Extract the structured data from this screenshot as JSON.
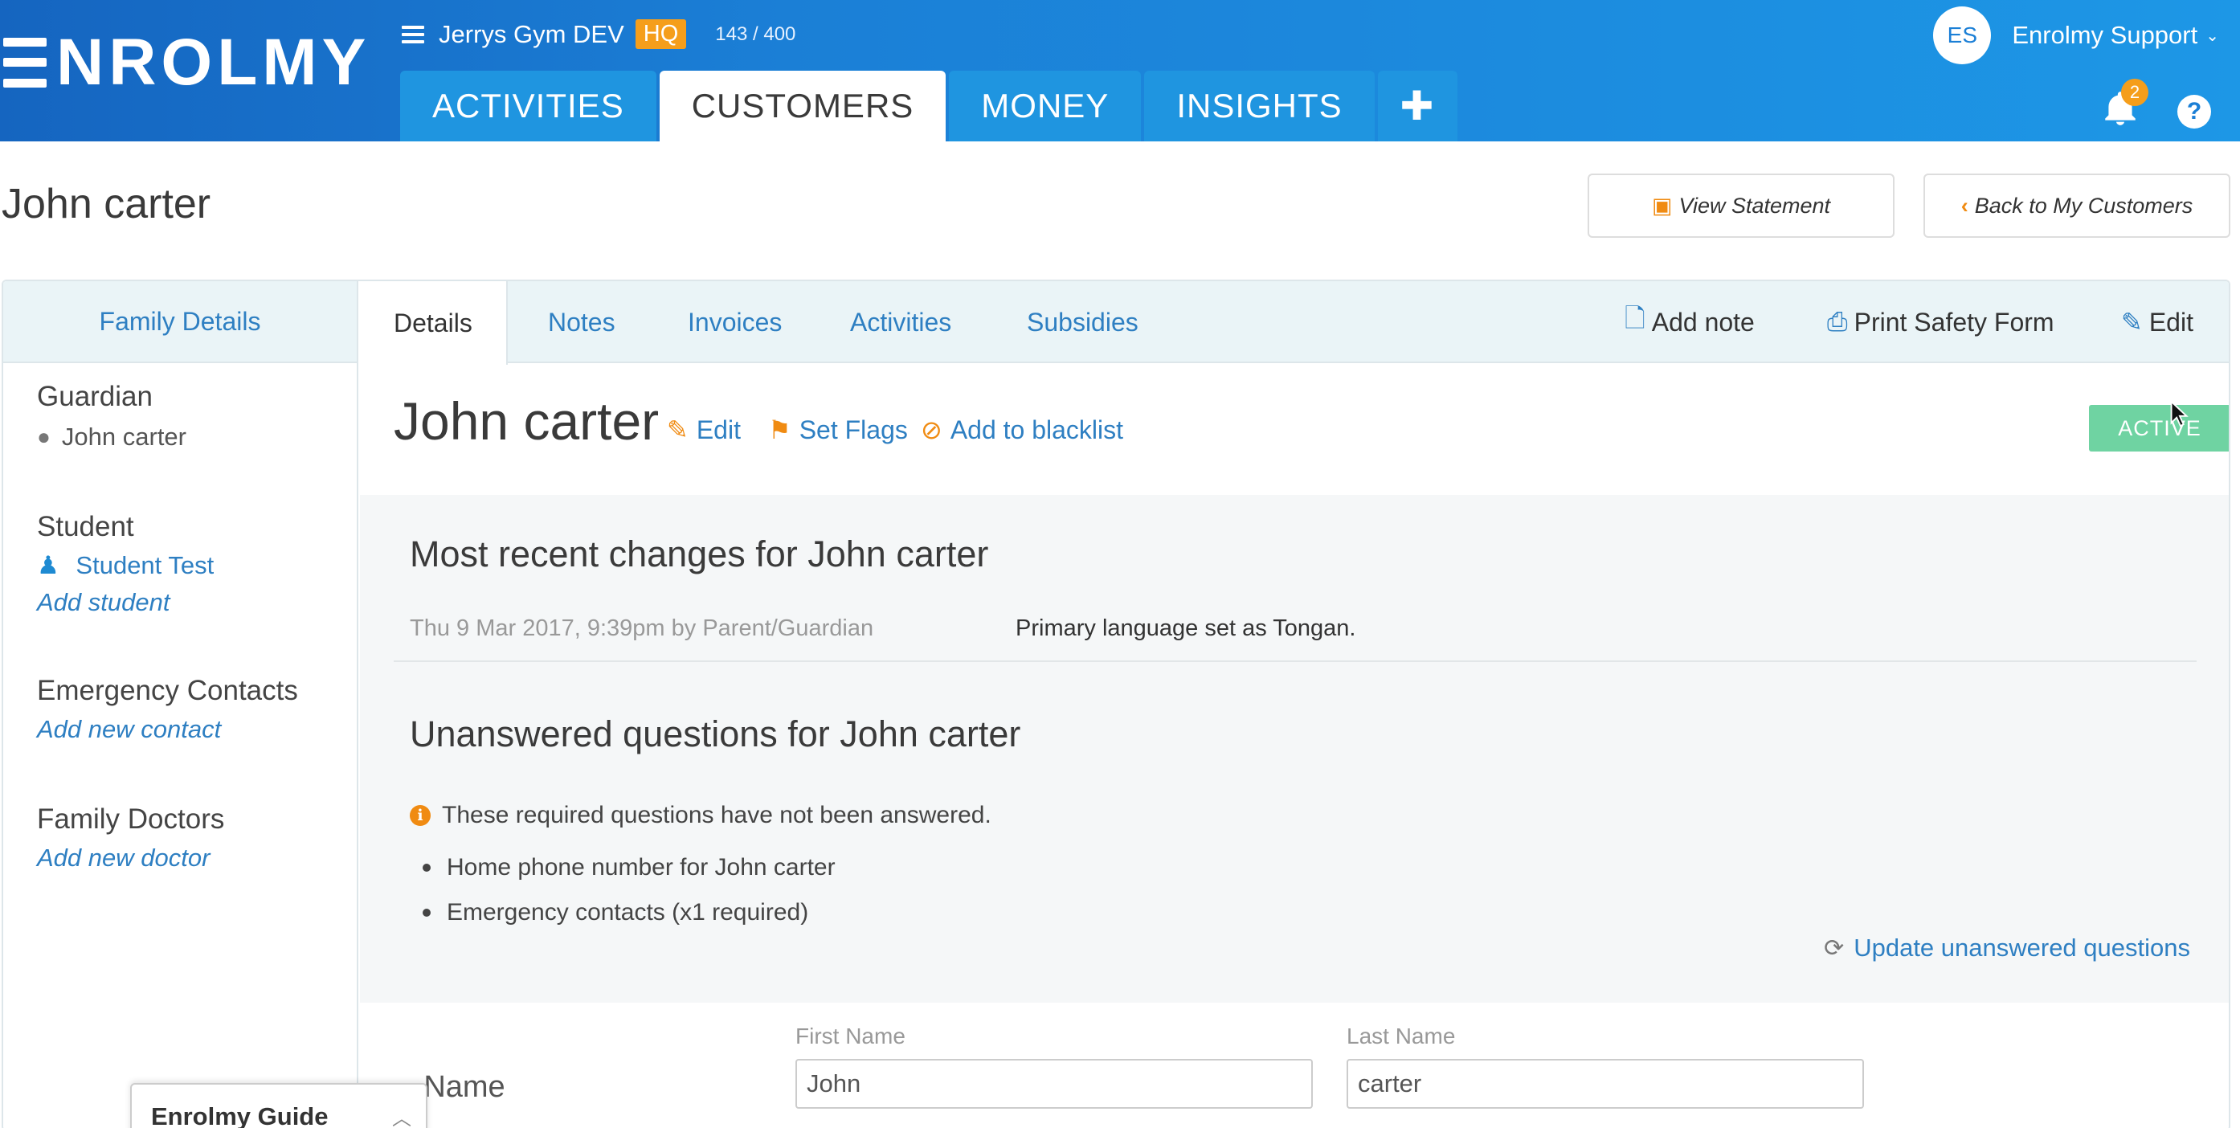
{
  "app": {
    "logo_text": "NROLMY",
    "org_name": "Jerrys Gym DEV",
    "org_badge": "HQ",
    "count": "143 / 400"
  },
  "nav": {
    "tabs": [
      {
        "label": "ACTIVITIES"
      },
      {
        "label": "CUSTOMERS",
        "active": true
      },
      {
        "label": "MONEY"
      },
      {
        "label": "INSIGHTS"
      }
    ],
    "plus": "✚"
  },
  "user": {
    "initials": "ES",
    "name": "Enrolmy Support",
    "notifications": "2",
    "help": "?"
  },
  "page": {
    "title": "John carter",
    "view_statement": "View Statement",
    "back": "Back to My Customers"
  },
  "sidebar": {
    "header": "Family Details",
    "guardian_title": "Guardian",
    "guardian_name": "John carter",
    "student_title": "Student",
    "student_name": "Student Test",
    "add_student": "Add student",
    "emergency_title": "Emergency Contacts",
    "add_contact": "Add new contact",
    "doctors_title": "Family Doctors",
    "add_doctor": "Add new doctor"
  },
  "subtabs": {
    "details": "Details",
    "notes": "Notes",
    "invoices": "Invoices",
    "activities": "Activities",
    "subsidies": "Subsidies",
    "add_note": "Add note",
    "print_safety": "Print Safety Form",
    "edit": "Edit"
  },
  "customer": {
    "name": "John carter",
    "edit": "Edit",
    "set_flags": "Set Flags",
    "blacklist": "Add to blacklist",
    "status": "ACTIVE"
  },
  "changes": {
    "title": "Most recent changes for John carter",
    "meta": "Thu 9 Mar 2017, 9:39pm by Parent/Guardian",
    "text": "Primary language set as Tongan."
  },
  "unanswered": {
    "title": "Unanswered questions for John carter",
    "info": "These required questions have not been answered.",
    "items": [
      "Home phone number for John carter",
      "Emergency contacts (x1 required)"
    ],
    "update": "Update unanswered questions"
  },
  "name_form": {
    "label": "Name",
    "first_label": "First Name",
    "first_value": "John",
    "last_label": "Last Name",
    "last_value": "carter"
  },
  "guide": {
    "title": "Enrolmy Guide"
  },
  "colors": {
    "header_start": "#1565c0",
    "header_end": "#1d97e6",
    "accent_orange": "#f59e1b",
    "link_blue": "#2e7fc2",
    "status_green": "#6fd3a2"
  }
}
